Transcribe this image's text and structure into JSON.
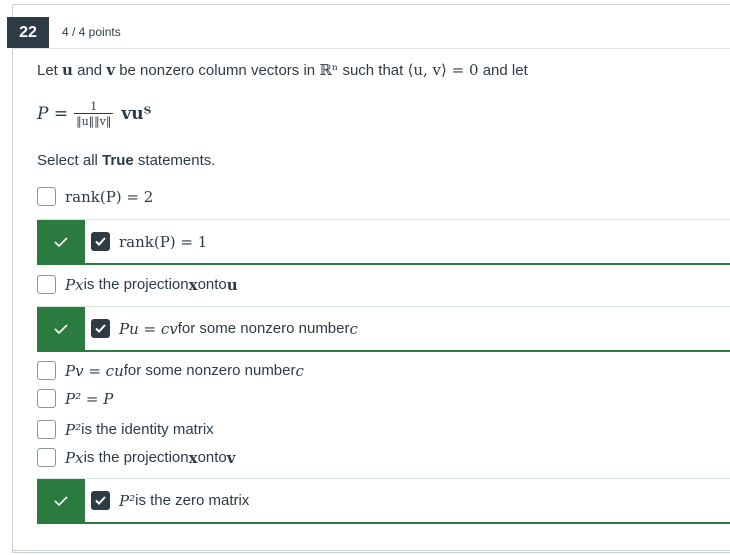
{
  "question": {
    "number": "22",
    "points": "4 / 4 points",
    "prompt": {
      "t1": "Let ",
      "u": "u",
      "t2": " and ",
      "v": "v",
      "t3": " be nonzero column vectors in ",
      "Rn": "ℝⁿ",
      "t4": " such that ",
      "inner": "⟨u, v⟩ = 0",
      "t5": " and let"
    },
    "formula": {
      "lhs": "P =",
      "frac_num": "1",
      "frac_den": "‖u‖‖v‖",
      "rhs": "vuᵀ"
    },
    "select_prefix": "Select all ",
    "select_bold": "True",
    "select_suffix": " statements."
  },
  "options": [
    {
      "math": "rank(P) = 2",
      "text": "",
      "checked": false,
      "correct": false
    },
    {
      "math": "rank(P) = 1",
      "text": "",
      "checked": true,
      "correct": true
    },
    {
      "math": "Px",
      "text": " is the projection ",
      "x": "x",
      "text2": " onto ",
      "vec": "u",
      "checked": false,
      "correct": false
    },
    {
      "math": "Pu = cv",
      "text": " for some nonzero number ",
      "tail": "c",
      "checked": true,
      "correct": true
    },
    {
      "math": "Pv = cu",
      "text": " for some nonzero number ",
      "tail": "c",
      "checked": false,
      "correct": false
    },
    {
      "math": "P² = P",
      "text": "",
      "checked": false,
      "correct": false
    },
    {
      "math": "P²",
      "text": " is the identity matrix",
      "checked": false,
      "correct": false
    },
    {
      "math": "Px",
      "text": " is the projection ",
      "x": "x",
      "text2": " onto ",
      "vec": "v",
      "checked": false,
      "correct": false
    },
    {
      "math": "P²",
      "text": " is the zero matrix",
      "checked": true,
      "correct": true
    }
  ],
  "colors": {
    "correct": "#2b7a3f",
    "dark": "#2d3b45"
  }
}
